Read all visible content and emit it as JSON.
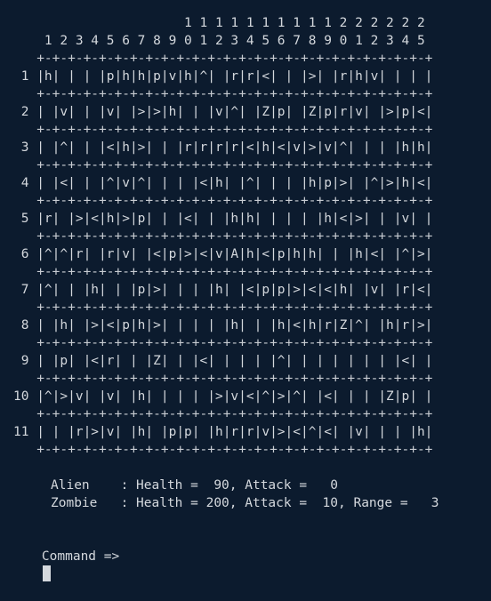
{
  "header_tens": "                      1 1 1 1 1 1 1 1 1 1 2 2 2 2 2 2",
  "header_ones": "    1 2 3 4 5 6 7 8 9 0 1 2 3 4 5 6 7 8 9 0 1 2 3 4 5",
  "border": "   +-+-+-+-+-+-+-+-+-+-+-+-+-+-+-+-+-+-+-+-+-+-+-+-+-+",
  "rows": [
    " 1 |h| | | |p|h|h|p|v|h|^| |r|r|<| | |>| |r|h|v| | | |",
    " 2 | |v| | |v| |>|>|h| | |v|^| |Z|p| |Z|p|r|v| |>|p|<|",
    " 3 | |^| | |<|h|>| | |r|r|r|r|<|h|<|v|>|v|^| | | |h|h|",
    " 4 | |<| | |^|v|^| | | |<|h| |^| | | |h|p|>| |^|>|h|<|",
    " 5 |r| |>|<|h|>|p| | |<| | |h|h| | | | |h|<|>| | |v| |",
    " 6 |^|^|r| |r|v| |<|p|>|<|v|A|h|<|p|h|h| | |h|<| |^|>|",
    " 7 |^| | |h| | |p|>| | | |h| |<|p|p|>|<|<|h| |v| |r|<|",
    " 8 | |h| |>|<|p|h|>| | | | |h| | |h|<|h|r|Z|^| |h|r|>|",
    " 9 | |p| |<|r| | |Z| | |<| | | | |^| | | | | | | |<| |",
    "10 |^|>|v| |v| |h| | | | |>|v|<|^|>|^| |<| | | |Z|p| |",
    "11 | | |r|>|v| |h| |p|p| |h|r|r|v|>|<|^|<| |v| | | |h|"
  ],
  "status": {
    "alien": "Alien    : Health =  90, Attack =   0",
    "zombie": "Zombie   : Health = 200, Attack =  10, Range =   3"
  },
  "prompt": {
    "label": "Command =>"
  }
}
